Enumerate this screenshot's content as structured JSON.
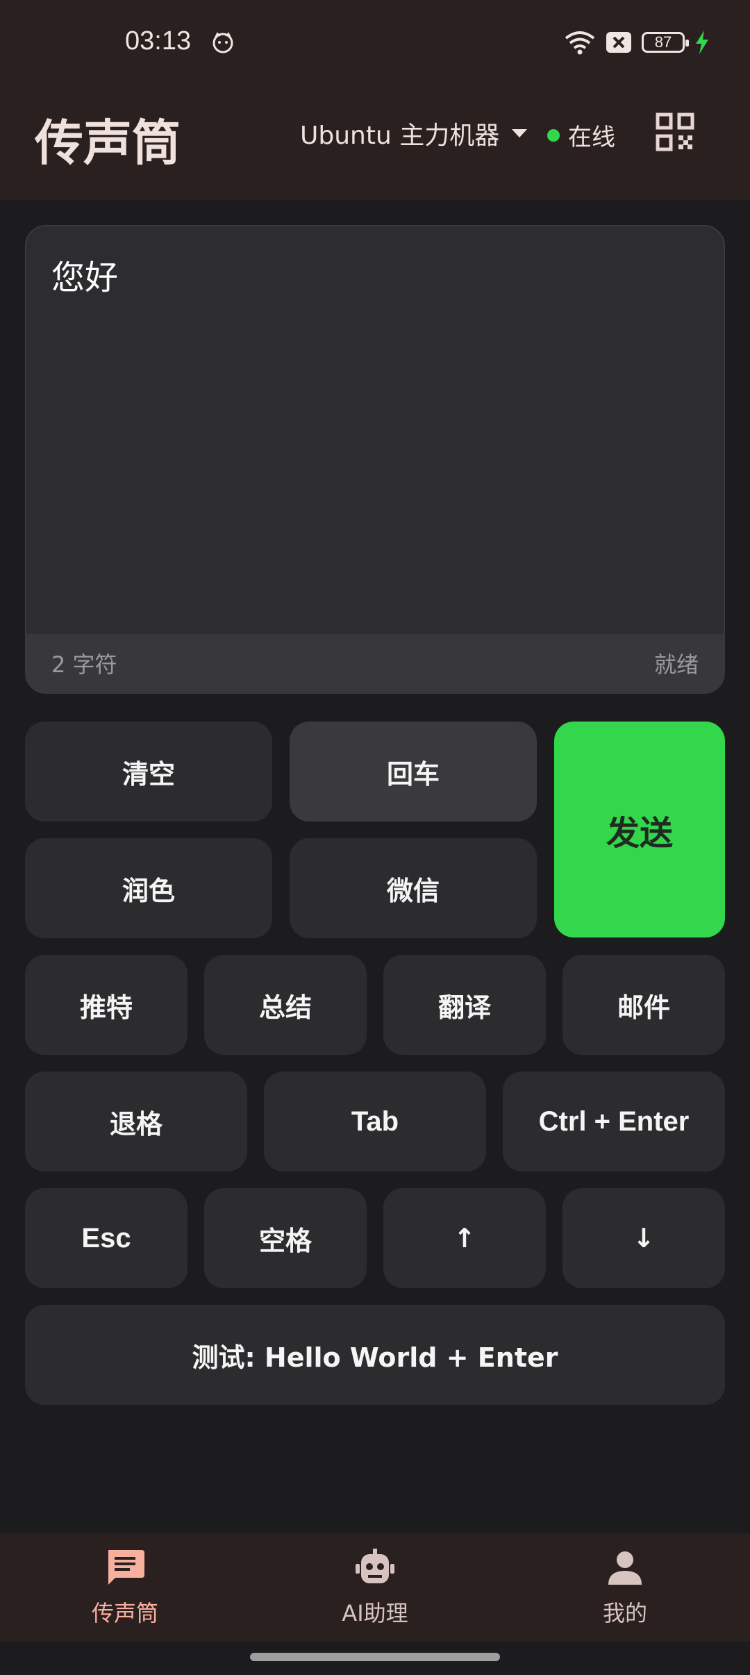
{
  "status": {
    "time": "03:13",
    "battery": "87"
  },
  "app": {
    "title": "传声筒",
    "device": "Ubuntu 主力机器",
    "online": "在线"
  },
  "input": {
    "text": "您好",
    "char_count": "2 字符",
    "state": "就绪"
  },
  "buttons": {
    "clear": "清空",
    "enter": "回车",
    "send": "发送",
    "polish": "润色",
    "wechat": "微信",
    "tweet": "推特",
    "summary": "总结",
    "translate": "翻译",
    "email": "邮件",
    "backspace": "退格",
    "tab": "Tab",
    "ctrl_enter": "Ctrl + Enter",
    "esc": "Esc",
    "space": "空格",
    "up": "↑",
    "down": "↓",
    "test": "测试: Hello World + Enter"
  },
  "nav": {
    "items": [
      {
        "label": "传声筒",
        "icon": "chat-icon"
      },
      {
        "label": "AI助理",
        "icon": "robot-icon"
      },
      {
        "label": "我的",
        "icon": "person-icon"
      }
    ]
  },
  "colors": {
    "accent": "#32d74b",
    "nav_active": "#f8b09e",
    "header_bg": "#2a201f"
  }
}
